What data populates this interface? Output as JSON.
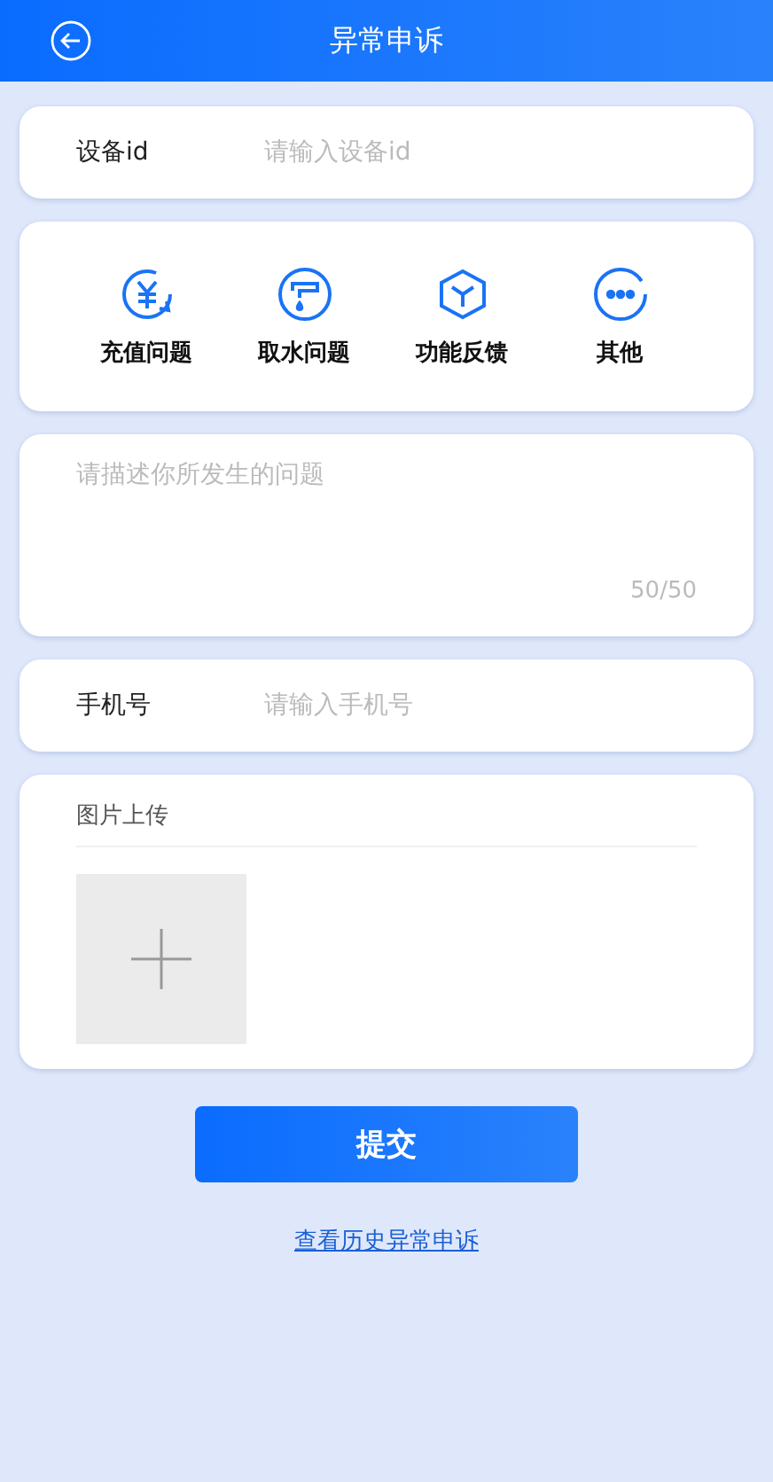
{
  "header": {
    "title": "异常申诉"
  },
  "device": {
    "label": "设备id",
    "placeholder": "请输入设备id"
  },
  "categories": [
    {
      "label": "充值问题",
      "kind": "recharge"
    },
    {
      "label": "取水问题",
      "kind": "faucet"
    },
    {
      "label": "功能反馈",
      "kind": "cube"
    },
    {
      "label": "其他",
      "kind": "more"
    }
  ],
  "description": {
    "placeholder": "请描述你所发生的问题",
    "counter": "50/50"
  },
  "phone": {
    "label": "手机号",
    "placeholder": "请输入手机号"
  },
  "upload": {
    "title": "图片上传"
  },
  "submit": "提交",
  "history_link": "查看历史异常申诉"
}
